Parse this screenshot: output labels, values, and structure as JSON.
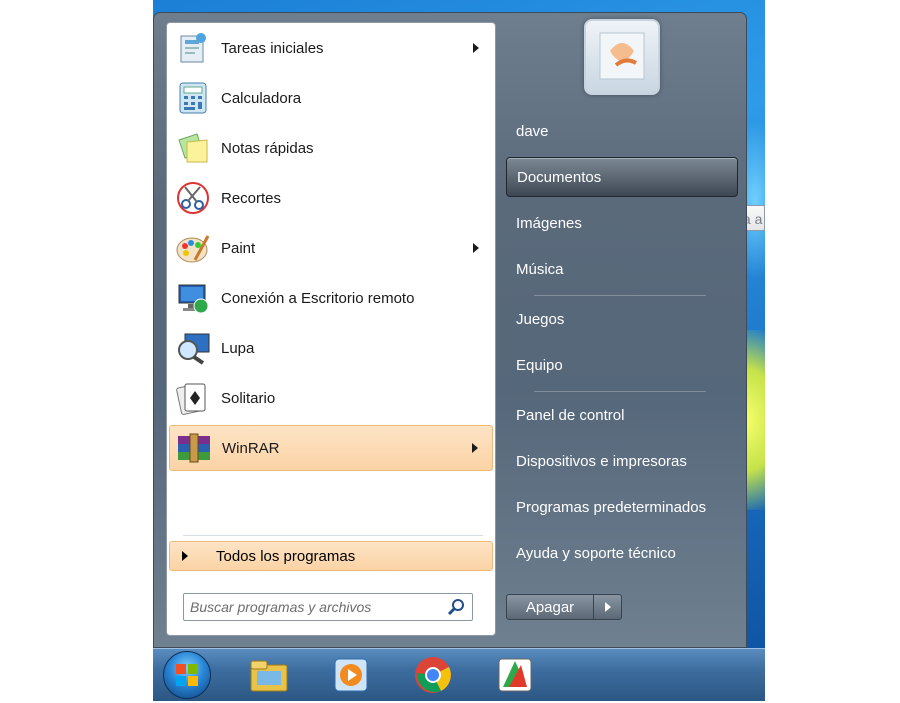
{
  "tooltip": "Obtenga a",
  "programs": [
    {
      "label": "Tareas iniciales",
      "icon": "getting-started-icon",
      "submenu": true
    },
    {
      "label": "Calculadora",
      "icon": "calculator-icon",
      "submenu": false
    },
    {
      "label": "Notas rápidas",
      "icon": "sticky-notes-icon",
      "submenu": false
    },
    {
      "label": "Recortes",
      "icon": "snipping-tool-icon",
      "submenu": false
    },
    {
      "label": "Paint",
      "icon": "paint-icon",
      "submenu": true
    },
    {
      "label": "Conexión a Escritorio remoto",
      "icon": "remote-desktop-icon",
      "submenu": false
    },
    {
      "label": "Lupa",
      "icon": "magnifier-icon",
      "submenu": false
    },
    {
      "label": "Solitario",
      "icon": "solitaire-icon",
      "submenu": false
    },
    {
      "label": "WinRAR",
      "icon": "winrar-icon",
      "submenu": true
    }
  ],
  "all_programs": "Todos los programas",
  "search": {
    "placeholder": "Buscar programas y archivos"
  },
  "right_items": [
    {
      "label": "dave"
    },
    {
      "label": "Documentos"
    },
    {
      "label": "Imágenes"
    },
    {
      "label": "Música"
    },
    {
      "label": "Juegos"
    },
    {
      "label": "Equipo"
    },
    {
      "label": "Panel de control"
    },
    {
      "label": "Dispositivos e impresoras"
    },
    {
      "label": "Programas predeterminados"
    },
    {
      "label": "Ayuda y soporte técnico"
    }
  ],
  "shutdown": {
    "label": "Apagar"
  },
  "taskbar": [
    "start-orb-icon",
    "file-explorer-icon",
    "media-player-icon",
    "chrome-icon",
    "winrar-taskbar-icon"
  ]
}
